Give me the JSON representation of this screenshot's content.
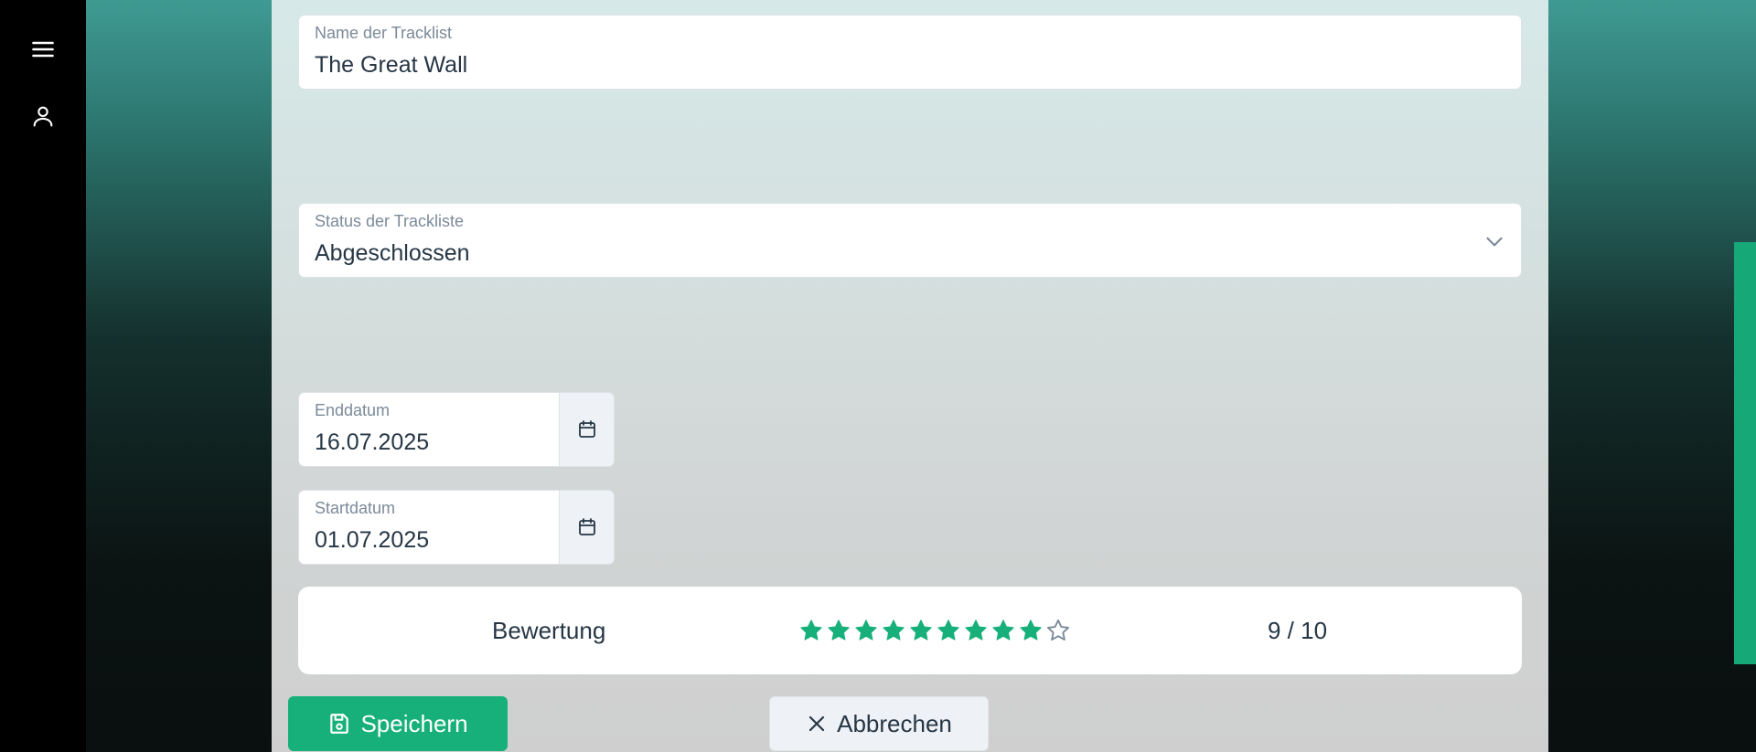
{
  "colors": {
    "accent": "#17b07b",
    "star_filled": "#17b07b",
    "star_empty": "#7b8a99"
  },
  "sidebar": {
    "menu_icon": "menu-icon",
    "user_icon": "user-icon"
  },
  "form": {
    "name": {
      "label": "Name der Tracklist",
      "value": "The Great Wall"
    },
    "status": {
      "label": "Status der Trackliste",
      "value": "Abgeschlossen"
    },
    "end_date": {
      "label": "Enddatum",
      "value": "16.07.2025"
    },
    "start_date": {
      "label": "Startdatum",
      "value": "01.07.2025"
    }
  },
  "rating": {
    "label": "Bewertung",
    "score": 9,
    "max": 10,
    "display": "9 / 10"
  },
  "actions": {
    "save_label": "Speichern",
    "cancel_label": "Abbrechen"
  }
}
